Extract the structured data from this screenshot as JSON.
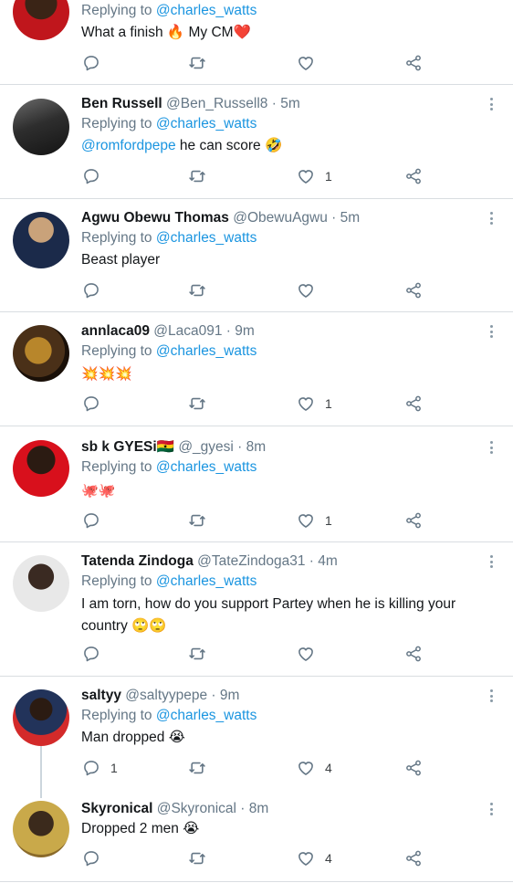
{
  "tweets": [
    {
      "name": "",
      "handle": "",
      "time": "",
      "reply_prefix": "Replying to ",
      "reply_to": "@charles_watts",
      "mention": "",
      "text": "What a finish 🔥 My CM❤️",
      "reply_count": "",
      "like_count": "",
      "avatar_colors": [
        "#c0161c",
        "#3a2416"
      ]
    },
    {
      "name": "Ben Russell",
      "handle": "@Ben_Russell8",
      "time": "5m",
      "reply_prefix": "Replying to ",
      "reply_to": "@charles_watts",
      "mention": "@romfordpepe",
      "text": " he can score 🤣",
      "reply_count": "",
      "like_count": "1",
      "avatar_colors": [
        "#4a4a4a",
        "#1f1f1f"
      ]
    },
    {
      "name": "Agwu Obewu Thomas",
      "handle": "@ObewuAgwu",
      "time": "5m",
      "reply_prefix": "Replying to ",
      "reply_to": "@charles_watts",
      "mention": "",
      "text": "Beast player",
      "reply_count": "",
      "like_count": "",
      "avatar_colors": [
        "#1b2a4a",
        "#c9a27a"
      ]
    },
    {
      "name": "annlaca09",
      "handle": "@Laca091",
      "time": "9m",
      "reply_prefix": "Replying to ",
      "reply_to": "@charles_watts",
      "mention": "",
      "text": "💥💥💥",
      "reply_count": "",
      "like_count": "1",
      "avatar_colors": [
        "#b8862b",
        "#2a1a10"
      ]
    },
    {
      "name": "sb k GYESi🇬🇭",
      "handle": "@_gyesi",
      "time": "8m",
      "reply_prefix": "Replying to ",
      "reply_to": "@charles_watts",
      "mention": "",
      "text": "🐙🐙",
      "reply_count": "",
      "like_count": "1",
      "avatar_colors": [
        "#d8101c",
        "#2b1b12"
      ]
    },
    {
      "name": "Tatenda Zindoga",
      "handle": "@TateZindoga31",
      "time": "4m",
      "reply_prefix": "Replying to ",
      "reply_to": "@charles_watts",
      "mention": "",
      "text": "I am torn, how do you support Partey when he is killing your country 🙄🙄",
      "reply_count": "",
      "like_count": "",
      "avatar_colors": [
        "#e8e8e8",
        "#3a2a22"
      ]
    },
    {
      "name": "saltyy",
      "handle": "@saltyypepe",
      "time": "9m",
      "reply_prefix": "Replying to ",
      "reply_to": "@charles_watts",
      "mention": "",
      "text": "Man dropped 😭",
      "reply_count": "1",
      "like_count": "4",
      "avatar_colors": [
        "#d32a2a",
        "#22335a"
      ]
    },
    {
      "name": "Skyronical",
      "handle": "@Skyronical",
      "time": "8m",
      "reply_prefix": "",
      "reply_to": "",
      "mention": "",
      "text": "Dropped 2 men 😭",
      "reply_count": "",
      "like_count": "4",
      "avatar_colors": [
        "#c9a94a",
        "#3b2a1c"
      ]
    }
  ],
  "icons": {
    "reply": "reply-icon",
    "retweet": "retweet-icon",
    "like": "heart-icon",
    "share": "share-icon",
    "more": "more-vertical-icon"
  },
  "colors": {
    "link": "#1b95e0",
    "secondary_text": "#657786",
    "icon": "#657786",
    "divider": "#d9dde1"
  }
}
